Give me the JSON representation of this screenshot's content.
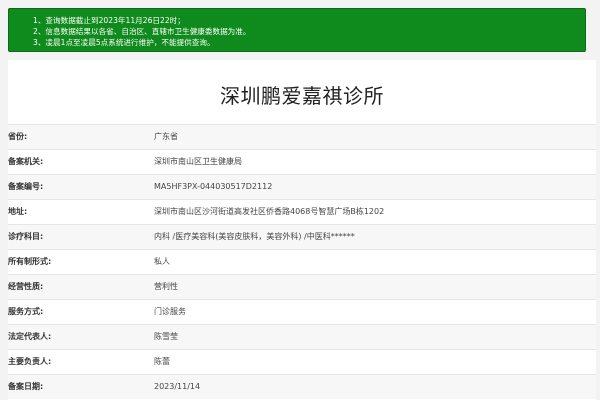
{
  "notice": {
    "lines": [
      "1、查询数据截止到2023年11月26日22时；",
      "2、信息数据结果以各省、自治区、直辖市卫生健康委数据为准。",
      "3、凌晨1点至凌晨5点系统进行维护，不能提供查询。"
    ]
  },
  "record": {
    "title": "深圳鹏爱嘉祺诊所",
    "fields": [
      {
        "label": "省份:",
        "value": "广东省"
      },
      {
        "label": "备案机关:",
        "value": "深圳市南山区卫生健康局"
      },
      {
        "label": "备案编号:",
        "value": "MA5HF3PX-044030517D2112"
      },
      {
        "label": "地址:",
        "value": "深圳市南山区沙河街道高发社区侨香路4068号智慧广场B栋1202"
      },
      {
        "label": "诊疗科目:",
        "value": "内科 /医疗美容科(美容皮肤科，美容外科) /中医科******"
      },
      {
        "label": "所有制形式:",
        "value": "私人"
      },
      {
        "label": "经营性质:",
        "value": "营利性"
      },
      {
        "label": "服务方式:",
        "value": "门诊服务"
      },
      {
        "label": "法定代表人:",
        "value": "陈雪莹"
      },
      {
        "label": "主要负责人:",
        "value": "陈蕾"
      },
      {
        "label": "备案日期:",
        "value": "2023/11/14"
      }
    ]
  }
}
